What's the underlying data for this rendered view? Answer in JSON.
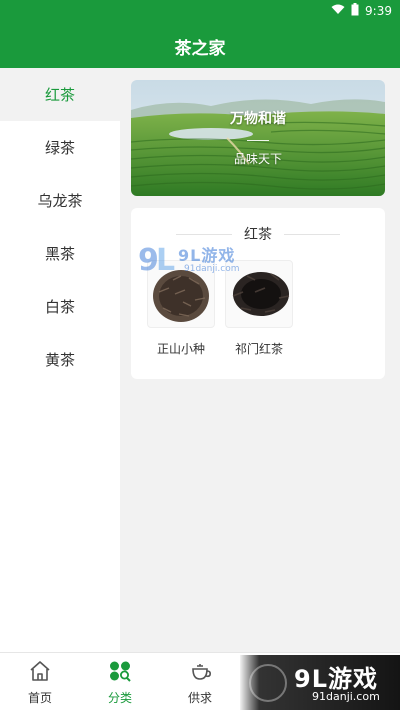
{
  "status_bar": {
    "time": "9:39"
  },
  "header": {
    "title": "茶之家"
  },
  "sidebar": {
    "items": [
      {
        "label": "红茶",
        "active": true
      },
      {
        "label": "绿茶",
        "active": false
      },
      {
        "label": "乌龙茶",
        "active": false
      },
      {
        "label": "黑茶",
        "active": false
      },
      {
        "label": "白茶",
        "active": false
      },
      {
        "label": "黄茶",
        "active": false
      }
    ]
  },
  "banner": {
    "title": "万物和谐",
    "subtitle": "品味天下"
  },
  "category_card": {
    "title": "红茶",
    "products": [
      {
        "name": "正山小种",
        "icon": "loose-tea-leaves"
      },
      {
        "name": "祁门红茶",
        "icon": "loose-tea-leaves"
      }
    ]
  },
  "bottom_nav": {
    "items": [
      {
        "label": "首页",
        "icon": "home-icon"
      },
      {
        "label": "分类",
        "icon": "category-icon",
        "active": true
      },
      {
        "label": "供求",
        "icon": "teapot-icon"
      }
    ]
  },
  "watermark": {
    "brand": "9L游戏",
    "url": "91danji.com"
  },
  "colors": {
    "primary": "#1a9a3c",
    "sidebar_bg": "#ffffff",
    "page_bg": "#f2f2f2"
  }
}
